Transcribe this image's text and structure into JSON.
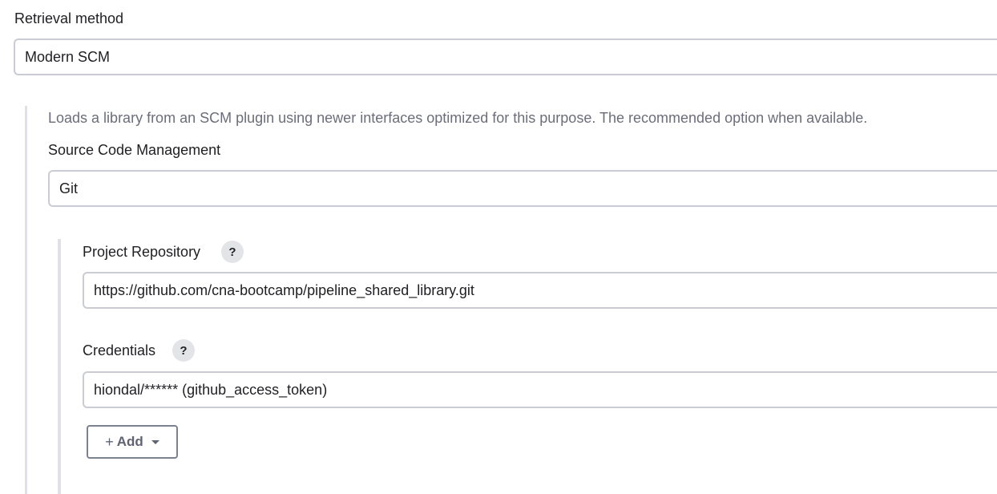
{
  "retrieval": {
    "label": "Retrieval method",
    "selected": "Modern SCM",
    "description": "Loads a library from an SCM plugin using newer interfaces optimized for this purpose. The recommended option when available."
  },
  "scm": {
    "label": "Source Code Management",
    "selected": "Git"
  },
  "repository": {
    "label": "Project Repository",
    "help": "?",
    "value": "https://github.com/cna-bootcamp/pipeline_shared_library.git"
  },
  "credentials": {
    "label": "Credentials",
    "help": "?",
    "selected": "hiondal/****** (github_access_token)",
    "add_plus": "+",
    "add_label": "Add"
  },
  "icons": {
    "help": "question-mark-icon",
    "add_caret": "caret-down-icon"
  }
}
